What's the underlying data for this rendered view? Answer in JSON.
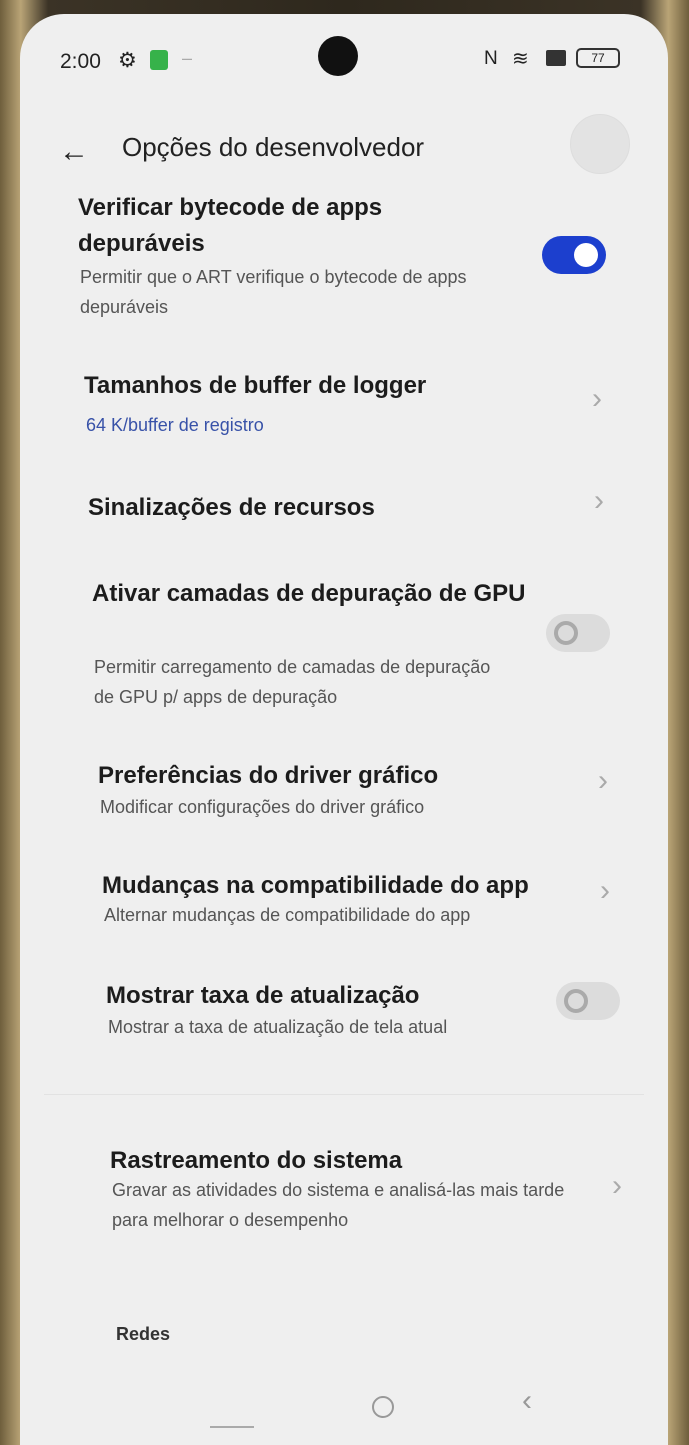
{
  "status_bar": {
    "time": "2:00",
    "battery": "77",
    "icons": [
      "gear-icon",
      "app-notification-icon",
      "nfc-icon",
      "wifi-icon",
      "sim-icon",
      "battery-icon"
    ]
  },
  "header": {
    "title": "Opções do desenvolvedor",
    "back_icon": "arrow-left-icon"
  },
  "items": [
    {
      "title": "Verificar bytecode de apps depuráveis",
      "subtitle": "Permitir que o ART verifique o bytecode de apps depuráveis",
      "control": "toggle",
      "state": "on"
    },
    {
      "title": "Tamanhos de buffer de logger",
      "subtitle": "64 K/buffer de registro",
      "control": "chevron"
    },
    {
      "title": "Sinalizações de recursos",
      "control": "chevron"
    },
    {
      "title": "Ativar camadas de depuração de GPU",
      "subtitle": "Permitir carregamento de camadas de depuração de GPU p/ apps de depuração",
      "control": "toggle",
      "state": "off"
    },
    {
      "title": "Preferências do driver gráfico",
      "subtitle": "Modificar configurações do driver gráfico",
      "control": "chevron"
    },
    {
      "title": "Mudanças na compatibilidade do app",
      "subtitle": "Alternar mudanças de compatibilidade do app",
      "control": "chevron"
    },
    {
      "title": "Mostrar taxa de atualização",
      "subtitle": "Mostrar a taxa de atualização de tela atual",
      "control": "toggle",
      "state": "off"
    },
    {
      "title": "Rastreamento do sistema",
      "subtitle": "Gravar as atividades do sistema e analisá-las mais tarde para melhorar o desempenho",
      "control": "chevron"
    }
  ],
  "section": {
    "label": "Redes"
  },
  "nav": {
    "recents_icon": "recents-icon",
    "home_icon": "home-icon",
    "back_icon": "back-icon"
  },
  "colors": {
    "accent": "#1c3fce",
    "background": "#efefef"
  }
}
